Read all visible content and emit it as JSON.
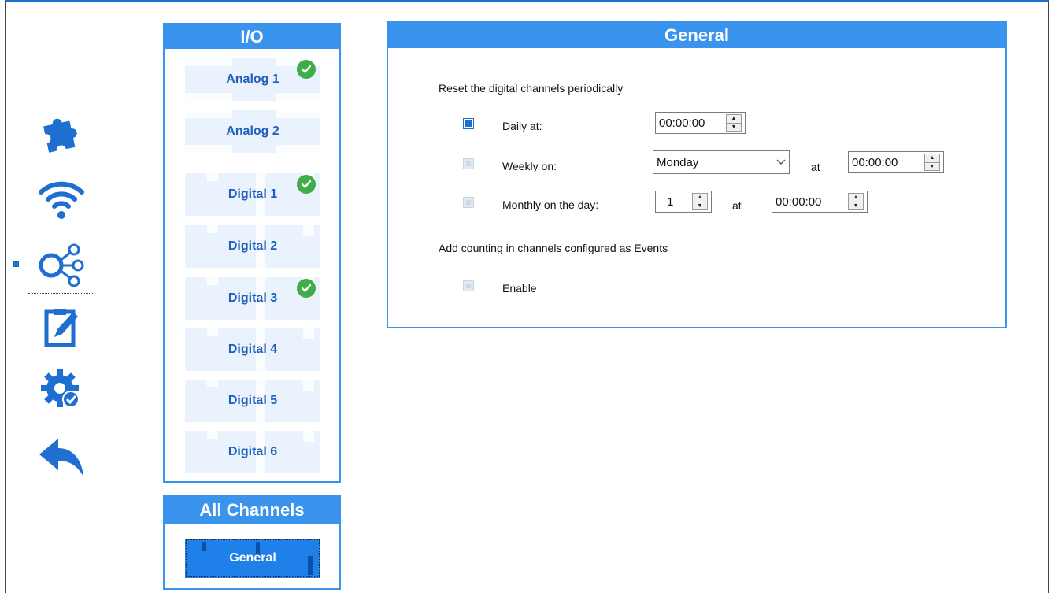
{
  "rail": {
    "items": [
      "puzzle-icon",
      "wifi-icon",
      "network-icon",
      "edit-clipboard-icon",
      "settings-check-icon",
      "back-arrow-icon"
    ],
    "selected": "network-icon"
  },
  "io_panel": {
    "title": "I/O",
    "items": [
      {
        "label": "Analog 1",
        "configured": true
      },
      {
        "label": "Analog 2",
        "configured": false
      },
      {
        "label": "Digital 1",
        "configured": true
      },
      {
        "label": "Digital 2",
        "configured": false
      },
      {
        "label": "Digital 3",
        "configured": true
      },
      {
        "label": "Digital 4",
        "configured": false
      },
      {
        "label": "Digital 5",
        "configured": false
      },
      {
        "label": "Digital 6",
        "configured": false
      }
    ]
  },
  "all_channels": {
    "title": "All Channels",
    "general_label": "General"
  },
  "general": {
    "title": "General",
    "reset_heading": "Reset the digital channels periodically",
    "daily": {
      "label": "Daily at:",
      "checked": true,
      "time": "00:00:00"
    },
    "weekly": {
      "label": "Weekly on:",
      "checked": false,
      "day": "Monday",
      "at_label": "at",
      "time": "00:00:00"
    },
    "monthly": {
      "label": "Monthly on the day:",
      "checked": false,
      "day": "1",
      "at_label": "at",
      "time": "00:00:00"
    },
    "counting_heading": "Add counting in channels configured as Events",
    "enable": {
      "label": "Enable",
      "checked": false
    }
  },
  "colors": {
    "accent": "#3a94ee",
    "selected": "#1e80e8",
    "check": "#3fae49",
    "icon": "#1e6fd0"
  }
}
